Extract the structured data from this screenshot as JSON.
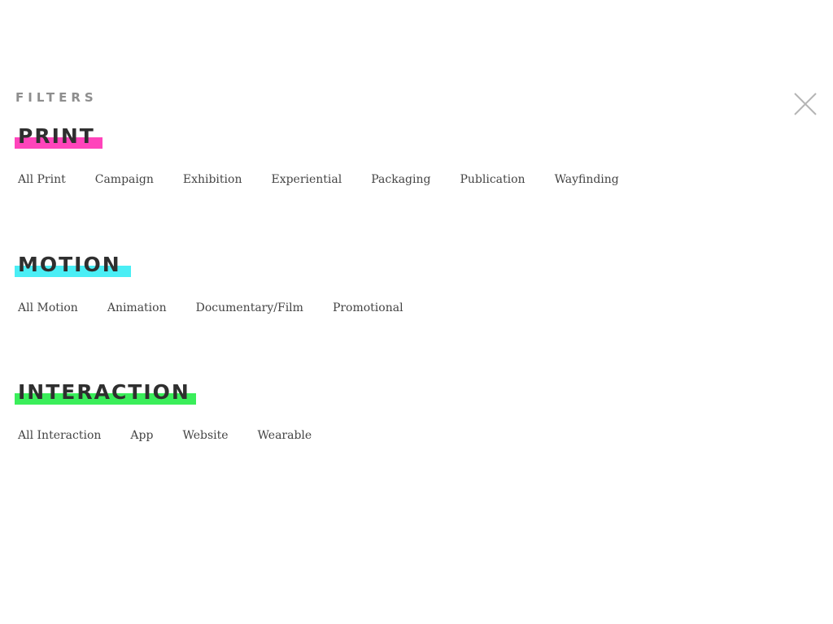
{
  "header": {
    "filters_label": "FILTERS",
    "close_label": "Close"
  },
  "colors": {
    "print_accent": "#ff44bb",
    "motion_accent": "#4aeef5",
    "interaction_accent": "#3aee5a"
  },
  "sections": [
    {
      "title": "PRINT",
      "items": [
        "All Print",
        "Campaign",
        "Exhibition",
        "Experiential",
        "Packaging",
        "Publication",
        "Wayfinding"
      ]
    },
    {
      "title": "MOTION",
      "items": [
        "All Motion",
        "Animation",
        "Documentary/Film",
        "Promotional"
      ]
    },
    {
      "title": "INTERACTION",
      "items": [
        "All Interaction",
        "App",
        "Website",
        "Wearable"
      ]
    }
  ]
}
